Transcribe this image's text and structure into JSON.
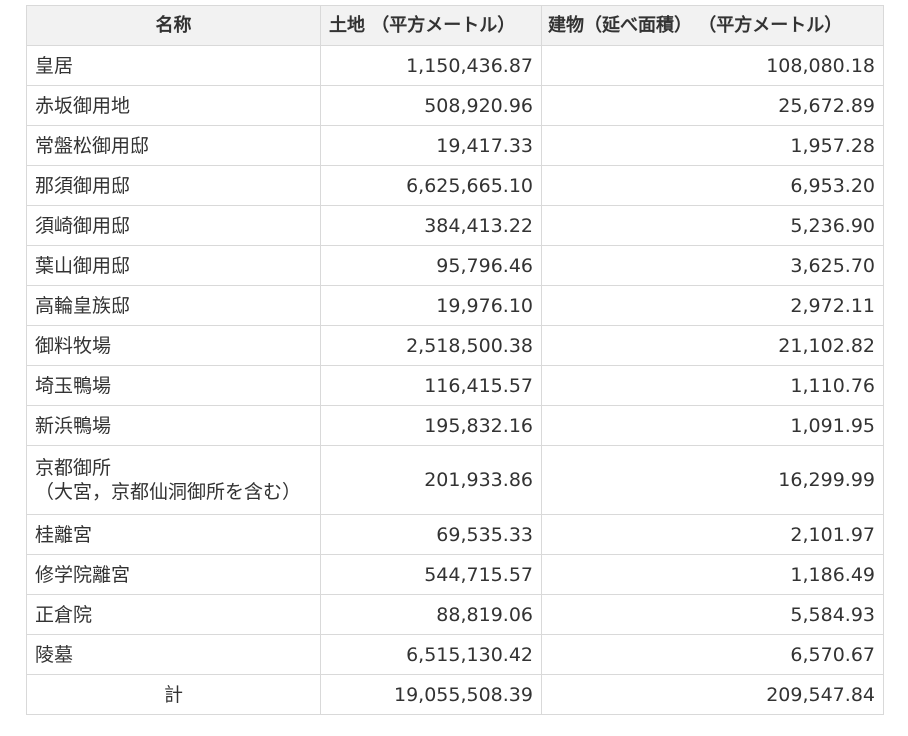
{
  "headers": {
    "name": "名称",
    "land": "土地 （平方メートル）",
    "building": "建物（延べ面積） （平方メートル）"
  },
  "rows": [
    {
      "name": "皇居",
      "land": "1,150,436.87",
      "building": "108,080.18"
    },
    {
      "name": "赤坂御用地",
      "land": "508,920.96",
      "building": "25,672.89"
    },
    {
      "name": "常盤松御用邸",
      "land": "19,417.33",
      "building": "1,957.28"
    },
    {
      "name": "那須御用邸",
      "land": "6,625,665.10",
      "building": "6,953.20"
    },
    {
      "name": "須崎御用邸",
      "land": "384,413.22",
      "building": "5,236.90"
    },
    {
      "name": "葉山御用邸",
      "land": "95,796.46",
      "building": "3,625.70"
    },
    {
      "name": "高輪皇族邸",
      "land": "19,976.10",
      "building": "2,972.11"
    },
    {
      "name": "御料牧場",
      "land": "2,518,500.38",
      "building": "21,102.82"
    },
    {
      "name": "埼玉鴨場",
      "land": "116,415.57",
      "building": "1,110.76"
    },
    {
      "name": "新浜鴨場",
      "land": "195,832.16",
      "building": "1,091.95"
    },
    {
      "name": "京都御所",
      "name_sub": "（大宮，京都仙洞御所を含む）",
      "land": "201,933.86",
      "building": "16,299.99"
    },
    {
      "name": "桂離宮",
      "land": "69,535.33",
      "building": "2,101.97"
    },
    {
      "name": "修学院離宮",
      "land": "544,715.57",
      "building": "1,186.49"
    },
    {
      "name": "正倉院",
      "land": "88,819.06",
      "building": "5,584.93"
    },
    {
      "name": "陵墓",
      "land": "6,515,130.42",
      "building": "6,570.67"
    }
  ],
  "total": {
    "label": "計",
    "land": "19,055,508.39",
    "building": "209,547.84"
  }
}
